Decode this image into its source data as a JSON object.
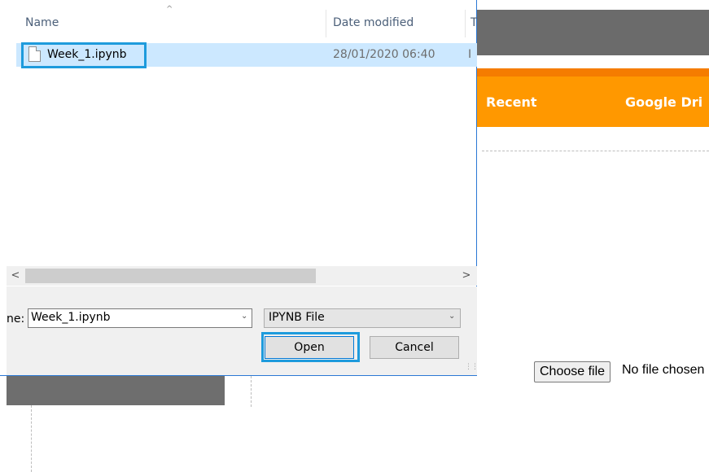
{
  "background_page": {
    "tabs": [
      "Recent",
      "Google Dri"
    ],
    "choose_file_label": "Choose file",
    "no_file_text": "No file chosen"
  },
  "dialog": {
    "columns": {
      "name": "Name",
      "date": "Date modified",
      "type": "T"
    },
    "sort_indicator": "^",
    "file": {
      "name": "Week_1.ipynb",
      "date": "28/01/2020 06:40",
      "type": "I"
    },
    "scroll_left": "<",
    "scroll_right": ">",
    "filename_label": "ne:",
    "filename_value": "Week_1.ipynb",
    "filetype_value": "IPYNB File",
    "open_label": "Open",
    "cancel_label": "Cancel"
  },
  "colors": {
    "accent_orange": "#ff9800",
    "selection_blue": "#cce8ff",
    "highlight_box": "#1e9bdc"
  }
}
